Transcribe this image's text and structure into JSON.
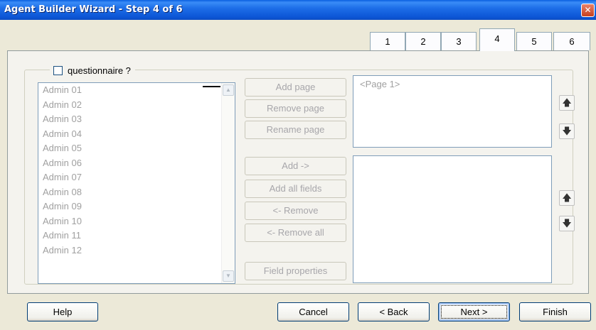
{
  "window": {
    "title": "Agent Builder Wizard - Step 4 of 6",
    "close_glyph": "✕"
  },
  "tabs": [
    "1",
    "2",
    "3",
    "4",
    "5",
    "6"
  ],
  "active_tab": "4",
  "questionnaire": {
    "label": "questionnaire ?",
    "checked": false
  },
  "fields_list": [
    "Admin 01",
    "Admin 02",
    "Admin 03",
    "Admin 04",
    "Admin 05",
    "Admin 06",
    "Admin 07",
    "Admin 08",
    "Admin 09",
    "Admin 10",
    "Admin 11",
    "Admin 12"
  ],
  "page_buttons": {
    "add": "Add page",
    "remove": "Remove page",
    "rename": "Rename page"
  },
  "field_buttons": {
    "add": "Add ->",
    "add_all": "Add all fields",
    "remove": "<- Remove",
    "remove_all": "<- Remove all",
    "properties": "Field properties"
  },
  "pages_list": [
    "<Page 1>"
  ],
  "icons": {
    "up": "arrow-up-icon",
    "down": "arrow-down-icon"
  },
  "footer": {
    "help": "Help",
    "cancel": "Cancel",
    "back": "< Back",
    "next": "Next >",
    "finish": "Finish"
  },
  "colors": {
    "titlebar": "#0c56d6",
    "window_bg": "#ece9d8",
    "disabled_text": "#a0a0a0"
  }
}
